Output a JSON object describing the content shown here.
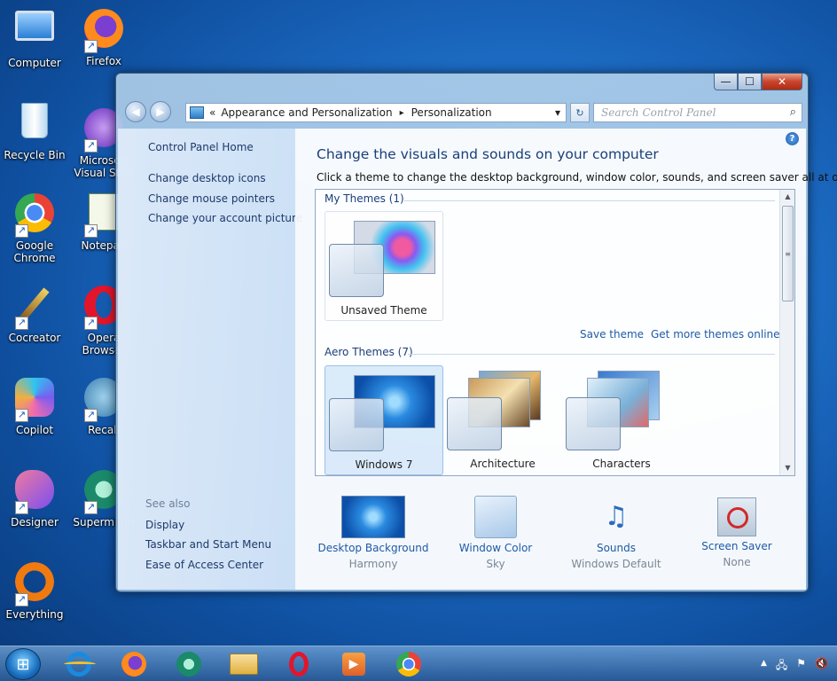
{
  "desktop": {
    "icons": [
      {
        "label": "Computer"
      },
      {
        "label": "Firefox"
      },
      {
        "label": "Recycle Bin"
      },
      {
        "label": "Microsoft Visual Stud"
      },
      {
        "label": "Google Chrome"
      },
      {
        "label": "Notepad"
      },
      {
        "label": "Cocreator"
      },
      {
        "label": "Opera Browser"
      },
      {
        "label": "Copilot"
      },
      {
        "label": "Recall"
      },
      {
        "label": "Designer"
      },
      {
        "label": "Supermium"
      },
      {
        "label": "Everything"
      }
    ]
  },
  "window": {
    "caption": {
      "minimize": "—",
      "maximize": "☐",
      "close": "✕"
    },
    "address": {
      "prefix": "«",
      "crumb1": "Appearance and Personalization",
      "sep": "▸",
      "crumb2": "Personalization",
      "dropdown": "▾"
    },
    "refresh": "↻",
    "search": {
      "placeholder": "Search Control Panel",
      "icon": "⌕"
    },
    "left_pane": {
      "home": "Control Panel Home",
      "links": [
        "Change desktop icons",
        "Change mouse pointers",
        "Change your account picture"
      ],
      "see_also": "See also",
      "see_also_links": [
        "Display",
        "Taskbar and Start Menu",
        "Ease of Access Center"
      ]
    },
    "main": {
      "help": "?",
      "heading": "Change the visuals and sounds on your computer",
      "subheading": "Click a theme to change the desktop background, window color, sounds, and screen saver all at once.",
      "my_themes_header": "My Themes (1)",
      "my_themes": [
        {
          "name": "Unsaved Theme"
        }
      ],
      "save_theme": "Save theme",
      "get_more": "Get more themes online",
      "aero_header": "Aero Themes (7)",
      "aero_themes": [
        {
          "name": "Windows 7"
        },
        {
          "name": "Architecture"
        },
        {
          "name": "Characters"
        }
      ],
      "scroll_up": "▲",
      "scroll_down": "▼",
      "scroll_grip": "≡",
      "bottom": [
        {
          "label": "Desktop Background",
          "value": "Harmony"
        },
        {
          "label": "Window Color",
          "value": "Sky"
        },
        {
          "label": "Sounds",
          "value": "Windows Default"
        },
        {
          "label": "Screen Saver",
          "value": "None"
        }
      ]
    }
  },
  "taskbar": {
    "start_glyph": "⊞",
    "pinned": [
      "internet-explorer",
      "firefox",
      "supermium",
      "file-explorer",
      "opera",
      "media-player",
      "chrome"
    ],
    "tray": {
      "chevron": "▲",
      "network": "🖧",
      "flag": "⚑",
      "volume": "🔇"
    }
  }
}
